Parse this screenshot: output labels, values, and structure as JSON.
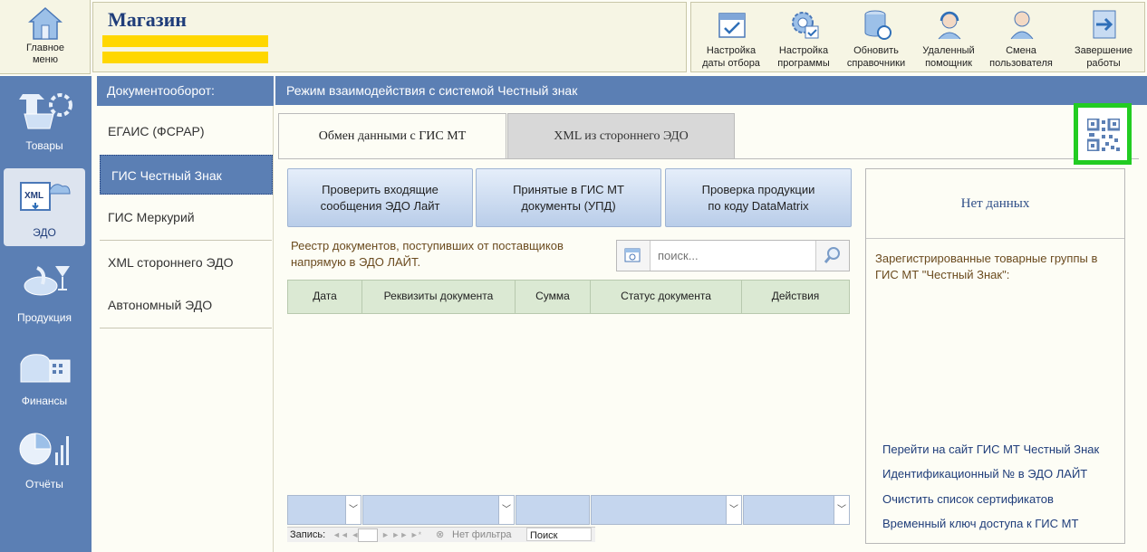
{
  "home": {
    "label_line1": "Главное",
    "label_line2": "меню",
    "icon": "home-icon"
  },
  "header": {
    "title": "Магазин"
  },
  "toolbar": {
    "buttons": [
      {
        "line1": "Настройка",
        "line2": "даты отбора",
        "icon": "calendar-icon"
      },
      {
        "line1": "Настройка",
        "line2": "программы",
        "icon": "settings-icon"
      },
      {
        "line1": "Обновить",
        "line2": "справочники",
        "icon": "database-refresh-icon"
      },
      {
        "line1": "Удаленный",
        "line2": "помощник",
        "icon": "headset-icon"
      },
      {
        "line1": "Смена",
        "line2": "пользователя",
        "icon": "user-switch-icon"
      },
      {
        "line1": "Завершение",
        "line2": "работы",
        "icon": "exit-icon"
      }
    ]
  },
  "leftnav": {
    "items": [
      {
        "label": "Товары",
        "icon": "goods-icon"
      },
      {
        "label": "ЭДО",
        "icon": "edo-xml-icon",
        "active": true
      },
      {
        "label": "Продукция",
        "icon": "products-icon"
      },
      {
        "label": "Финансы",
        "icon": "finance-icon"
      },
      {
        "label": "Отчёты",
        "icon": "reports-icon"
      }
    ]
  },
  "docpanel": {
    "heading": "Документооборот:",
    "items": [
      {
        "label": "ЕГАИС (ФСРАР)"
      },
      {
        "label": "ГИС Честный Знак",
        "active": true
      },
      {
        "label": "ГИС Меркурий"
      },
      {
        "label": "XML стороннего ЭДО"
      },
      {
        "label": "Автономный ЭДО"
      }
    ]
  },
  "main": {
    "heading": "Режим взаимодействия с системой Честный знак",
    "tabs": [
      {
        "label": "Обмен данными с ГИС МТ",
        "active": true
      },
      {
        "label": "XML из стороннего ЭДО"
      }
    ],
    "actions": [
      {
        "label": "Проверить входящие\nсообщения ЭДО Лайт"
      },
      {
        "label": "Принятые в ГИС МТ\nдокументы (УПД)"
      },
      {
        "label": "Проверка продукции\nпо коду DataMatrix"
      }
    ],
    "registry_label": "Реестр документов, поступивших от поставщиков напрямую в ЭДО ЛАЙТ.",
    "search": {
      "placeholder": "поиск..."
    },
    "table": {
      "columns": [
        "Дата",
        "Реквизиты документа",
        "Сумма",
        "Статус документа",
        "Действия"
      ]
    },
    "record_bar": {
      "label": "Запись:",
      "nav": "◄◄ ◄",
      "nav_next": "► ►► ►*",
      "filter": "Нет фильтра",
      "search": "Поиск"
    }
  },
  "side": {
    "no_data": "Нет данных",
    "groups_label": "Зарегистрированные товарные группы в ГИС МТ \"Честный Знак\":",
    "links": [
      "Перейти на сайт ГИС МТ Честный Знак",
      "Идентификационный № в ЭДО ЛАЙТ",
      "Очистить список сертификатов",
      "Временный ключ доступа к ГИС МТ"
    ]
  },
  "colors": {
    "accent": "#5b7fb4",
    "highlight": "#22cc22",
    "redacted": "#ffd700"
  }
}
